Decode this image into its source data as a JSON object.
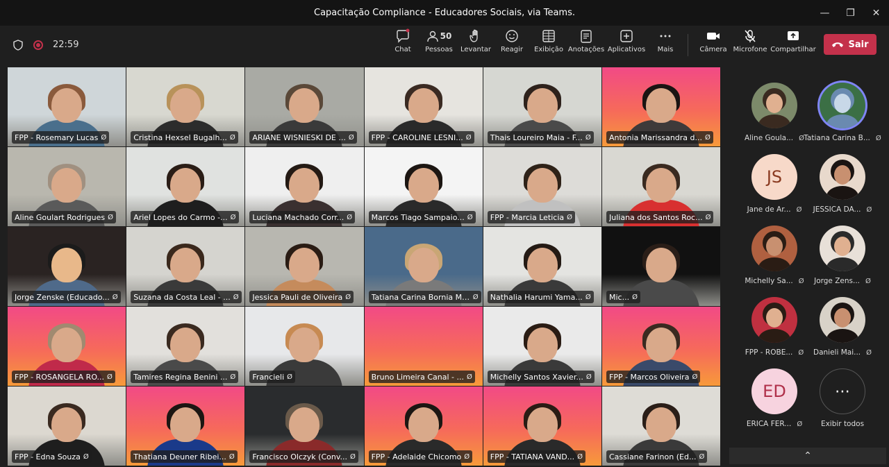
{
  "window": {
    "title": "Capacitação Compliance - Educadores Sociais, via Teams."
  },
  "toolbar": {
    "timer": "22:59",
    "chat": "Chat",
    "people": "Pessoas",
    "people_count": "50",
    "raise": "Levantar",
    "react": "Reagir",
    "view": "Exibição",
    "notes": "Anotações",
    "apps": "Aplicativos",
    "more": "Mais",
    "camera": "Câmera",
    "mic": "Microfone",
    "share": "Compartilhar",
    "leave": "Sair"
  },
  "grid": [
    {
      "name": "FPP - Rosemary Lucas"
    },
    {
      "name": "Cristina Hexsel Bugalh..."
    },
    {
      "name": "ARIANE WISNIESKI DE ..."
    },
    {
      "name": "FPP - CAROLINE LESNI..."
    },
    {
      "name": "Thais Loureiro Maia - F..."
    },
    {
      "name": "Antonia Marissandra d..."
    },
    {
      "name": "Aline Goulart Rodrigues"
    },
    {
      "name": "Ariel Lopes do Carmo -..."
    },
    {
      "name": "Luciana Machado Corr..."
    },
    {
      "name": "Marcos Tiago Sampaio..."
    },
    {
      "name": "FPP - Marcia Leticia"
    },
    {
      "name": "Juliana dos Santos Roc..."
    },
    {
      "name": "Jorge Zenske (Educado..."
    },
    {
      "name": "Suzana da Costa Leal - ..."
    },
    {
      "name": "Jessica Pauli de Oliveira"
    },
    {
      "name": "Tatiana Carina Bornia Mu..."
    },
    {
      "name": "Nathalia Harumi Yama..."
    },
    {
      "name": "Mic..."
    },
    {
      "name": "FPP - ROSANGELA RO..."
    },
    {
      "name": "Tamires Regina Benini ..."
    },
    {
      "name": "Francieli"
    },
    {
      "name": "Bruno Limeira Canal - ..."
    },
    {
      "name": "Michelly Santos Xavier..."
    },
    {
      "name": "FPP - Marcos  Oliveira"
    },
    {
      "name": "FPP - Edna  Souza"
    },
    {
      "name": "Thatiana  Deuner Ribei..."
    },
    {
      "name": "Francisco Olczyk (Conv..."
    },
    {
      "name": "FPP - Adelaide Chicomo"
    },
    {
      "name": "FPP - TATIANA  VAND..."
    },
    {
      "name": "Cassiane Farinon (Ed..."
    }
  ],
  "rail": [
    {
      "name": "Aline Goula...",
      "initials": ""
    },
    {
      "name": "Tatiana Carina B...",
      "initials": ""
    },
    {
      "name": "Jane de Ar...",
      "initials": "JS"
    },
    {
      "name": "JESSICA DA...",
      "initials": ""
    },
    {
      "name": "Michelly Sa...",
      "initials": ""
    },
    {
      "name": "Jorge Zens...",
      "initials": ""
    },
    {
      "name": "FPP - ROBE...",
      "initials": ""
    },
    {
      "name": "Danieli Mai...",
      "initials": ""
    },
    {
      "name": "ERICA FER...",
      "initials": "ED"
    },
    {
      "name": "Exibir todos",
      "initials": ""
    }
  ]
}
